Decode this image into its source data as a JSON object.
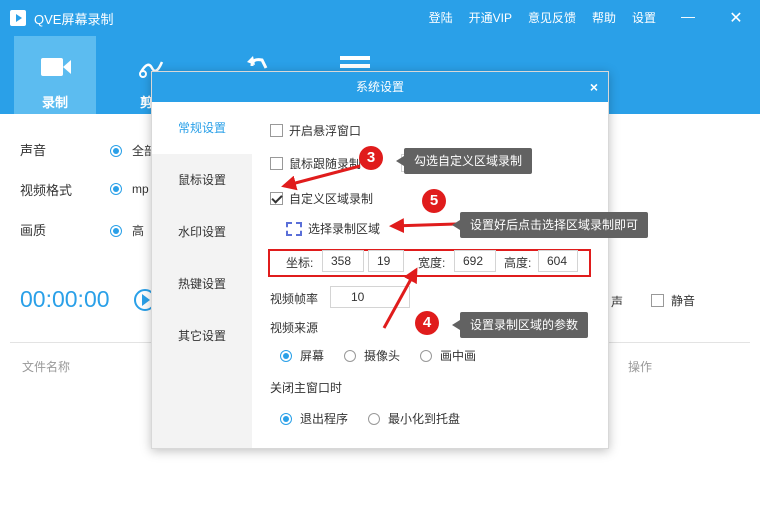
{
  "app": {
    "title": "QVE屏幕录制"
  },
  "topnav": [
    "登陆",
    "开通VIP",
    "意见反馈",
    "帮助",
    "设置"
  ],
  "toolbar": {
    "record_label": "录制",
    "second_label_partial": "剪"
  },
  "main": {
    "rows": [
      {
        "label": "声音",
        "option": "全部"
      },
      {
        "label": "视频格式",
        "option": "mp"
      },
      {
        "label": "画质",
        "option": "高"
      }
    ],
    "timer": "00:00:00",
    "sound_partial": "声",
    "mute_label": "静音",
    "col_filename": "文件名称",
    "col_actions": "操作"
  },
  "dialog": {
    "title": "系统设置",
    "close": "×",
    "sidebar": [
      "常规设置",
      "鼠标设置",
      "水印设置",
      "热键设置",
      "其它设置"
    ],
    "float_window": "开启悬浮窗口",
    "follow_mouse": "鼠标跟随录制",
    "custom_region": "自定义区域录制",
    "select_region": "选择录制区域",
    "coords_label": "坐标:",
    "x": "358",
    "y": "19",
    "width_label": "宽度:",
    "width": "692",
    "height_label": "高度:",
    "height": "604",
    "fps_label": "视频帧率",
    "fps": "10",
    "source_label": "视频来源",
    "sources": [
      "屏幕",
      "摄像头",
      "画中画"
    ],
    "close_main_label": "关闭主窗口时",
    "close_options": [
      "退出程序",
      "最小化到托盘"
    ]
  },
  "annotations": {
    "badge3": "3",
    "tip3": "勾选自定义区域录制",
    "badge5": "5",
    "tip5": "设置好后点击选择区域录制即可",
    "badge4": "4",
    "tip4": "设置录制区域的参数"
  },
  "colors": {
    "brand": "#2aa0e8",
    "annotation": "#e01c1c",
    "tooltip": "#626262"
  }
}
